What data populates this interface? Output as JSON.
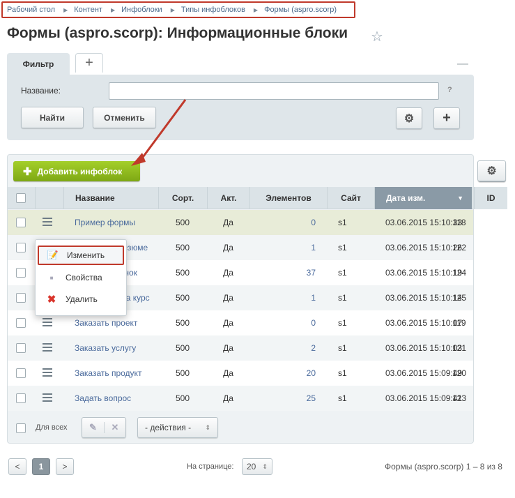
{
  "breadcrumb": [
    "Рабочий стол",
    "Контент",
    "Инфоблоки",
    "Типы инфоблоков",
    "Формы (aspro.scorp)"
  ],
  "page_title": "Формы (aspro.scorp): Информационные блоки",
  "filter": {
    "tab_label": "Фильтр",
    "add_tab": "+",
    "collapse": "—",
    "name_label": "Название:",
    "name_value": "",
    "help": "?",
    "find_button": "Найти",
    "cancel_button": "Отменить",
    "add_button": "+"
  },
  "toolbar": {
    "add_label": "Добавить инфоблок"
  },
  "columns": [
    "Название",
    "Сорт.",
    "Акт.",
    "Элементов",
    "Сайт",
    "Дата изм.",
    "ID"
  ],
  "rows": [
    {
      "name": "Пример формы",
      "sort": "500",
      "active": "Да",
      "elements": "0",
      "site": "s1",
      "date": "03.06.2015 15:10:33",
      "id": "118"
    },
    {
      "name": "Отправить резюме",
      "sort": "500",
      "active": "Да",
      "elements": "1",
      "site": "s1",
      "date": "03.06.2015 15:10:26",
      "id": "122"
    },
    {
      "name": "Заказать звонок",
      "sort": "500",
      "active": "Да",
      "elements": "37",
      "site": "s1",
      "date": "03.06.2015 15:10:19",
      "id": "124"
    },
    {
      "name": "Записаться на курс",
      "sort": "500",
      "active": "Да",
      "elements": "1",
      "site": "s1",
      "date": "03.06.2015 15:10:14",
      "id": "125"
    },
    {
      "name": "Заказать проект",
      "sort": "500",
      "active": "Да",
      "elements": "0",
      "site": "s1",
      "date": "03.06.2015 15:10:07",
      "id": "119"
    },
    {
      "name": "Заказать услугу",
      "sort": "500",
      "active": "Да",
      "elements": "2",
      "site": "s1",
      "date": "03.06.2015 15:10:03",
      "id": "121"
    },
    {
      "name": "Заказать продукт",
      "sort": "500",
      "active": "Да",
      "elements": "20",
      "site": "s1",
      "date": "03.06.2015 15:09:49",
      "id": "120"
    },
    {
      "name": "Задать вопрос",
      "sort": "500",
      "active": "Да",
      "elements": "25",
      "site": "s1",
      "date": "03.06.2015 15:09:41",
      "id": "123"
    }
  ],
  "context_menu": [
    "Изменить",
    "Свойства",
    "Удалить"
  ],
  "footer": {
    "for_all": "Для всех",
    "actions": "- действия -"
  },
  "pagination": {
    "prev": "<",
    "current": "1",
    "next": ">",
    "per_page_label": "На странице:",
    "per_page": "20",
    "summary": "Формы (aspro.scorp) 1 – 8 из 8"
  },
  "colors": {
    "accent_green": "#8cba1f",
    "link": "#4a6a9c",
    "highlight_red": "#c0392b"
  }
}
